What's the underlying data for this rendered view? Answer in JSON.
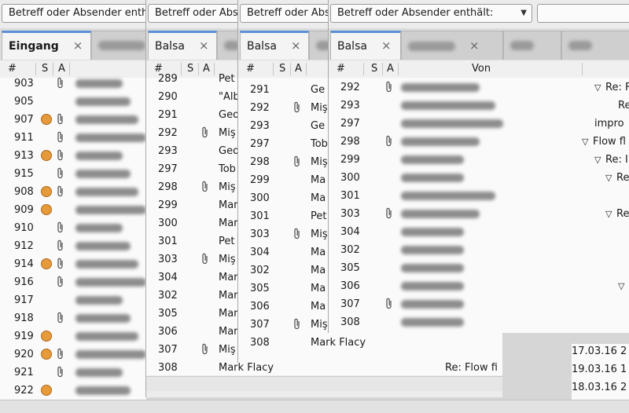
{
  "search": {
    "label": "Betreff oder Absender enthält:"
  },
  "columns": {
    "num": "#",
    "s": "S",
    "a": "A",
    "von": "Von"
  },
  "w1": {
    "tab_active": "Eingang",
    "rows": [
      {
        "n": "903",
        "clip": true,
        "fwd": false
      },
      {
        "n": "905",
        "clip": false,
        "fwd": false
      },
      {
        "n": "907",
        "clip": true,
        "fwd": true
      },
      {
        "n": "911",
        "clip": true,
        "fwd": false
      },
      {
        "n": "913",
        "clip": true,
        "fwd": true
      },
      {
        "n": "915",
        "clip": true,
        "fwd": false
      },
      {
        "n": "908",
        "clip": true,
        "fwd": true
      },
      {
        "n": "909",
        "clip": false,
        "fwd": true
      },
      {
        "n": "910",
        "clip": true,
        "fwd": false
      },
      {
        "n": "912",
        "clip": true,
        "fwd": false
      },
      {
        "n": "914",
        "clip": true,
        "fwd": true
      },
      {
        "n": "916",
        "clip": true,
        "fwd": false
      },
      {
        "n": "917",
        "clip": false,
        "fwd": false
      },
      {
        "n": "918",
        "clip": true,
        "fwd": false
      },
      {
        "n": "919",
        "clip": false,
        "fwd": true
      },
      {
        "n": "920",
        "clip": true,
        "fwd": true
      },
      {
        "n": "921",
        "clip": true,
        "fwd": false
      },
      {
        "n": "922",
        "clip": false,
        "fwd": true
      }
    ]
  },
  "w2": {
    "tab_active": "Balsa",
    "rows": [
      {
        "n": "289",
        "t": "Pet",
        "clip": false
      },
      {
        "n": "290",
        "t": "\"Alb",
        "clip": false
      },
      {
        "n": "291",
        "t": "Geo",
        "clip": false
      },
      {
        "n": "292",
        "t": "Miş",
        "clip": true
      },
      {
        "n": "293",
        "t": "Geo",
        "clip": false
      },
      {
        "n": "297",
        "t": "Tob",
        "clip": false
      },
      {
        "n": "298",
        "t": "Miş",
        "clip": true
      },
      {
        "n": "299",
        "t": "Mar",
        "clip": false
      },
      {
        "n": "300",
        "t": "Mar",
        "clip": false
      },
      {
        "n": "301",
        "t": "Pet",
        "clip": false
      },
      {
        "n": "303",
        "t": "Miş",
        "clip": true
      },
      {
        "n": "304",
        "t": "Mar",
        "clip": false
      },
      {
        "n": "302",
        "t": "Mar",
        "clip": false
      },
      {
        "n": "305",
        "t": "Mar",
        "clip": false
      },
      {
        "n": "306",
        "t": "Mar",
        "clip": false
      },
      {
        "n": "307",
        "t": "Miş",
        "clip": true
      },
      {
        "n": "308",
        "t": "Mark Flacy",
        "clip": false
      }
    ],
    "tail": "Re: Flow fi"
  },
  "w3": {
    "tab_active": "Balsa",
    "rows": [
      {
        "n": "291",
        "t": "Ge",
        "clip": false
      },
      {
        "n": "292",
        "t": "Miş",
        "clip": true
      },
      {
        "n": "293",
        "t": "Ge",
        "clip": false
      },
      {
        "n": "297",
        "t": "Tob",
        "clip": false
      },
      {
        "n": "298",
        "t": "Miş",
        "clip": true
      },
      {
        "n": "299",
        "t": "Ma",
        "clip": false
      },
      {
        "n": "300",
        "t": "Ma",
        "clip": false
      },
      {
        "n": "301",
        "t": "Pet",
        "clip": false
      },
      {
        "n": "303",
        "t": "Miş",
        "clip": true
      },
      {
        "n": "304",
        "t": "Ma",
        "clip": false
      },
      {
        "n": "302",
        "t": "Ma",
        "clip": false
      },
      {
        "n": "305",
        "t": "Ma",
        "clip": false
      },
      {
        "n": "306",
        "t": "Ma",
        "clip": false
      },
      {
        "n": "307",
        "t": "Miş",
        "clip": true
      },
      {
        "n": "308",
        "t": "Mark Flacy",
        "clip": false
      }
    ],
    "tail": "Re: Flo"
  },
  "w4": {
    "tab_active": "Balsa",
    "rows": [
      {
        "n": "292",
        "clip": true,
        "subj": "Re: F",
        "arrow": true
      },
      {
        "n": "293",
        "clip": false,
        "subj": "Re",
        "arrow": false
      },
      {
        "n": "297",
        "clip": false,
        "subj": "impro",
        "arrow": false
      },
      {
        "n": "298",
        "clip": true,
        "subj": "Flow fl",
        "arrow": true
      },
      {
        "n": "299",
        "clip": false,
        "subj": "Re: I",
        "arrow": true
      },
      {
        "n": "300",
        "clip": false,
        "subj": "Re",
        "arrow": true
      },
      {
        "n": "301",
        "clip": false,
        "subj": "",
        "arrow": false
      },
      {
        "n": "303",
        "clip": true,
        "subj": "Re",
        "arrow": true
      },
      {
        "n": "304",
        "clip": false,
        "subj": "",
        "arrow": false
      },
      {
        "n": "302",
        "clip": false,
        "subj": "",
        "arrow": false
      },
      {
        "n": "305",
        "clip": false,
        "subj": "",
        "arrow": false
      },
      {
        "n": "306",
        "clip": false,
        "subj": "",
        "arrow": true
      },
      {
        "n": "307",
        "clip": true,
        "subj": "",
        "arrow": false
      },
      {
        "n": "308",
        "clip": false,
        "subj": "",
        "arrow": false
      }
    ]
  },
  "dates": [
    "17.03.16 2",
    "19.03.16 1",
    "18.03.16 2"
  ]
}
